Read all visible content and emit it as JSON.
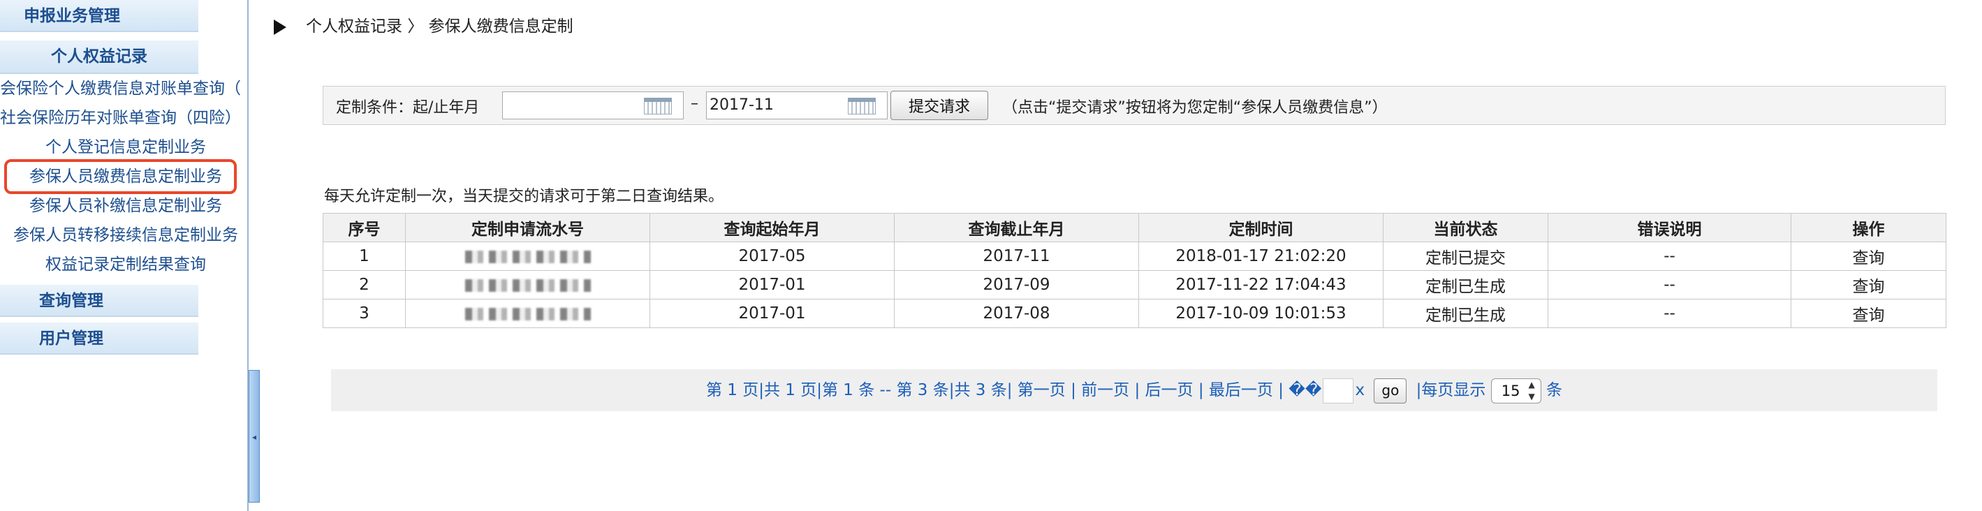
{
  "sidebar": {
    "section_declaration": "申报业务管理",
    "section_rights": "个人权益记录",
    "items": [
      {
        "label": "会保险个人缴费信息对账单查询（"
      },
      {
        "label": "社会保险历年对账单查询（四险）"
      },
      {
        "label": "个人登记信息定制业务"
      },
      {
        "label": "参保人员缴费信息定制业务"
      },
      {
        "label": "参保人员补缴信息定制业务"
      },
      {
        "label": "参保人员转移接续信息定制业务"
      },
      {
        "label": "权益记录定制结果查询"
      }
    ],
    "section_query": "查询管理",
    "section_user": "用户管理"
  },
  "breadcrumb": {
    "parent": "个人权益记录",
    "separator": "〉",
    "current": "参保人缴费信息定制"
  },
  "condition": {
    "label": "定制条件：起/止年月",
    "start_value": "",
    "dash": "–",
    "end_value": "2017-11",
    "submit_label": "提交请求",
    "hint": "（点击“提交请求”按钮将为您定制“参保人员缴费信息”）"
  },
  "note": "每天允许定制一次，当天提交的请求可于第二日查询结果。",
  "table": {
    "headers": [
      "序号",
      "定制申请流水号",
      "查询起始年月",
      "查询截止年月",
      "定制时间",
      "当前状态",
      "错误说明",
      "操作"
    ],
    "rows": [
      {
        "no": "1",
        "serial": "",
        "start": "2017-05",
        "end": "2017-11",
        "time": "2018-01-17 21:02:20",
        "status": "定制已提交",
        "error": "--",
        "action": "查询"
      },
      {
        "no": "2",
        "serial": "",
        "start": "2017-01",
        "end": "2017-09",
        "time": "2017-11-22 17:04:43",
        "status": "定制已生成",
        "error": "--",
        "action": "查询"
      },
      {
        "no": "3",
        "serial": "",
        "start": "2017-01",
        "end": "2017-08",
        "time": "2017-10-09 10:01:53",
        "status": "定制已生成",
        "error": "--",
        "action": "查询"
      }
    ]
  },
  "pager": {
    "info": "第 1 页|共 1 页|第 1 条 -- 第 3 条|共 3 条|",
    "first": "第一页",
    "sep": "|",
    "prev": "前一页",
    "next": "后一页",
    "last": "最后一页",
    "jump_garbled": "��",
    "jump_suffix": "x",
    "go_label": "go",
    "per_page_label": "|每页显示",
    "per_page_value": "15",
    "unit": "条"
  },
  "colors": {
    "nav_text": "#1d4f8f",
    "link": "#1d5fb8",
    "highlight_box": "#e8472b"
  }
}
